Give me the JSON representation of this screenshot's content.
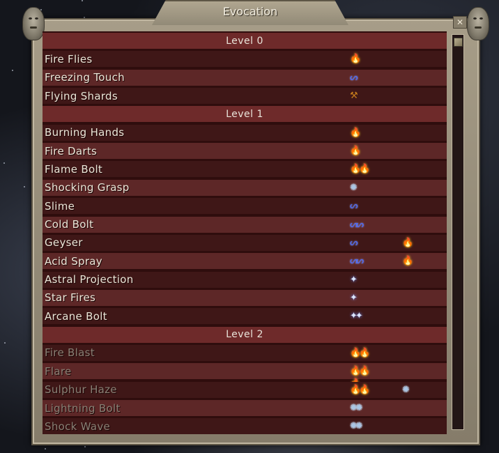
{
  "window": {
    "title": "Evocation",
    "close_glyph": "✕"
  },
  "list": [
    {
      "type": "header",
      "label": "Level 0"
    },
    {
      "type": "spell",
      "name": "Fire Flies",
      "icons": [
        "fire"
      ],
      "available": true
    },
    {
      "type": "spell",
      "name": "Freezing Touch",
      "icons": [
        "water"
      ],
      "available": true
    },
    {
      "type": "spell",
      "name": "Flying Shards",
      "icons": [
        "earth"
      ],
      "available": true
    },
    {
      "type": "header",
      "label": "Level 1"
    },
    {
      "type": "spell",
      "name": "Burning Hands",
      "icons": [
        "fire"
      ],
      "available": true
    },
    {
      "type": "spell",
      "name": "Fire Darts",
      "icons": [
        "fire"
      ],
      "available": true
    },
    {
      "type": "spell",
      "name": "Flame Bolt",
      "icons": [
        "fire-2"
      ],
      "available": true
    },
    {
      "type": "spell",
      "name": "Shocking Grasp",
      "icons": [
        "air"
      ],
      "available": true
    },
    {
      "type": "spell",
      "name": "Slime",
      "icons": [
        "water"
      ],
      "available": true
    },
    {
      "type": "spell",
      "name": "Cold Bolt",
      "icons": [
        "water-2"
      ],
      "available": true
    },
    {
      "type": "spell",
      "name": "Geyser",
      "icons": [
        "water",
        "fire"
      ],
      "available": true
    },
    {
      "type": "spell",
      "name": "Acid Spray",
      "icons": [
        "water-2",
        "fire"
      ],
      "available": true
    },
    {
      "type": "spell",
      "name": "Astral Projection",
      "icons": [
        "magic"
      ],
      "available": true
    },
    {
      "type": "spell",
      "name": "Star Fires",
      "icons": [
        "magic"
      ],
      "available": true
    },
    {
      "type": "spell",
      "name": "Arcane Bolt",
      "icons": [
        "magic-2"
      ],
      "available": true
    },
    {
      "type": "header",
      "label": "Level 2"
    },
    {
      "type": "spell",
      "name": "Fire Blast",
      "icons": [
        "fire-2"
      ],
      "available": false
    },
    {
      "type": "spell",
      "name": "Flare",
      "icons": [
        "fire-3"
      ],
      "available": false
    },
    {
      "type": "spell",
      "name": "Sulphur Haze",
      "icons": [
        "fire-2",
        "air"
      ],
      "available": false
    },
    {
      "type": "spell",
      "name": "Lightning Bolt",
      "icons": [
        "air-2"
      ],
      "available": false
    },
    {
      "type": "spell",
      "name": "Shock Wave",
      "icons": [
        "air-2"
      ],
      "available": false
    }
  ],
  "icon_glyphs": {
    "fire": "🔥",
    "water": "ᔕ",
    "earth": "⚒",
    "air": "✺",
    "magic": "✦"
  },
  "colors": {
    "header_row": "#6e2a2a",
    "row_light": "#5d2727",
    "row_dark": "#3f1717",
    "text_available": "#ece6d8",
    "text_unavailable": "#8a8075",
    "frame_stone": "#948b78"
  }
}
